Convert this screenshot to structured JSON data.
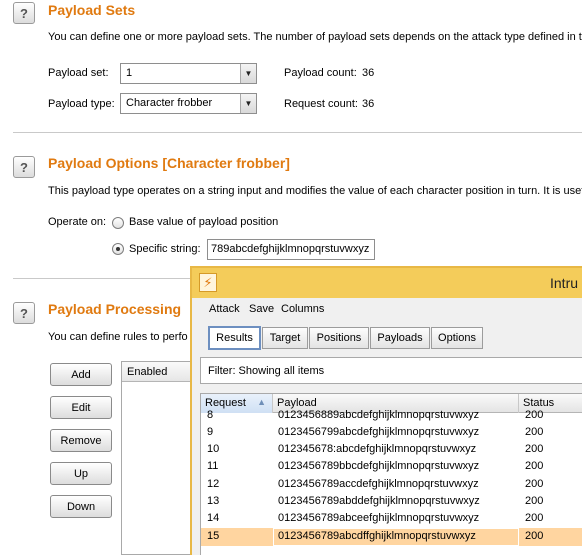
{
  "payload_sets": {
    "title": "Payload Sets",
    "description": "You can define one or more payload sets. The number of payload sets depends on the attack type defined in th",
    "set_label": "Payload set:",
    "set_value": "1",
    "type_label": "Payload type:",
    "type_value": "Character frobber",
    "count_label": "Payload count:",
    "count_value": "36",
    "request_label": "Request count:",
    "request_value": "36"
  },
  "payload_options": {
    "title": "Payload Options [Character frobber]",
    "description": "This payload type operates on a string input and modifies the value of each character position in turn. It is usefu",
    "operate_label": "Operate on:",
    "radio_base": "Base value of payload position",
    "radio_specific": "Specific string:",
    "specific_value": "789abcdefghijklmnopqrstuvwxyz",
    "selected": "specific"
  },
  "payload_processing": {
    "title": "Payload Processing",
    "description": "You can define rules to perfo",
    "buttons": [
      "Add",
      "Edit",
      "Remove",
      "Up",
      "Down"
    ],
    "table_header": "Enabled"
  },
  "intruder": {
    "title": "Intru",
    "menu": [
      "Attack",
      "Save",
      "Columns"
    ],
    "tabs": [
      "Results",
      "Target",
      "Positions",
      "Payloads",
      "Options"
    ],
    "active_tab": "Results",
    "filter": "Filter: Showing all items",
    "columns": [
      "Request",
      "Payload",
      "Status"
    ],
    "sort_indicator": "▲",
    "rows": [
      {
        "request": "8",
        "payload": "0123456889abcdefghijklmnopqrstuvwxyz",
        "status": "200"
      },
      {
        "request": "9",
        "payload": "0123456799abcdefghijklmnopqrstuvwxyz",
        "status": "200"
      },
      {
        "request": "10",
        "payload": "012345678:abcdefghijklmnopqrstuvwxyz",
        "status": "200"
      },
      {
        "request": "11",
        "payload": "0123456789bbcdefghijklmnopqrstuvwxyz",
        "status": "200"
      },
      {
        "request": "12",
        "payload": "0123456789accdefghijklmnopqrstuvwxyz",
        "status": "200"
      },
      {
        "request": "13",
        "payload": "0123456789abddefghijklmnopqrstuvwxyz",
        "status": "200"
      },
      {
        "request": "14",
        "payload": "0123456789abceefghijklmnopqrstuvwxyz",
        "status": "200"
      },
      {
        "request": "15",
        "payload": "0123456789abcdffghijklmnopqrstuvwxyz",
        "status": "200"
      }
    ],
    "selected_row": "15"
  },
  "colors": {
    "section_title": "#e07a10",
    "title_bar": "#f4cc5a",
    "selected_row": "#ffd5a0",
    "active_tab_border": "#6d8fc0"
  },
  "icons": [
    "help-icon",
    "dropdown-arrow-icon",
    "burp-logo-icon",
    "sort-ascending-icon"
  ]
}
